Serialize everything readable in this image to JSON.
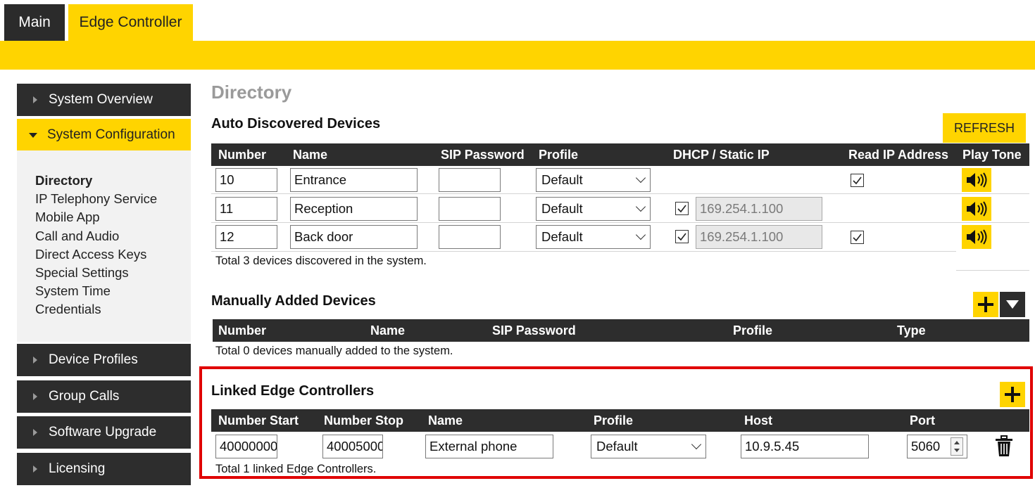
{
  "tabs": {
    "main": "Main",
    "edge": "Edge Controller"
  },
  "sidebar": {
    "system_overview": "System Overview",
    "system_configuration": "System Configuration",
    "sub_items": [
      "Directory",
      "IP Telephony Service",
      "Mobile App",
      "Call and Audio",
      "Direct Access Keys",
      "Special Settings",
      "System Time",
      "Credentials"
    ],
    "device_profiles": "Device Profiles",
    "group_calls": "Group Calls",
    "software_upgrade": "Software Upgrade",
    "licensing": "Licensing"
  },
  "page_title": "Directory",
  "auto": {
    "title": "Auto Discovered Devices",
    "refresh_label": "REFRESH",
    "headers": [
      "Number",
      "Name",
      "SIP Password",
      "Profile",
      "DHCP / Static IP",
      "Read IP Address",
      "Play Tone"
    ],
    "rows": [
      {
        "number": "10",
        "name": "Entrance",
        "sip_password": "",
        "profile": "Default",
        "static_ip_checked": false,
        "ip": "",
        "read_ip_checked": true
      },
      {
        "number": "11",
        "name": "Reception",
        "sip_password": "",
        "profile": "Default",
        "static_ip_checked": true,
        "ip": "169.254.1.100",
        "read_ip_checked": false
      },
      {
        "number": "12",
        "name": "Back door",
        "sip_password": "",
        "profile": "Default",
        "static_ip_checked": true,
        "ip": "169.254.1.100",
        "read_ip_checked": true
      }
    ],
    "total_note": "Total 3 devices discovered in the system."
  },
  "manual": {
    "title": "Manually Added Devices",
    "headers": [
      "Number",
      "Name",
      "SIP Password",
      "Profile",
      "Type"
    ],
    "total_note": "Total 0 devices manually added to the system."
  },
  "linked": {
    "title": "Linked Edge Controllers",
    "headers": [
      "Number Start",
      "Number Stop",
      "Name",
      "Profile",
      "Host",
      "Port"
    ],
    "row": {
      "number_start": "40000000",
      "number_stop": "40005000",
      "name": "External phone",
      "profile": "Default",
      "host": "10.9.5.45",
      "port": "5060"
    },
    "total_note": "Total 1 linked Edge Controllers."
  },
  "colors": {
    "accent": "#ffd400",
    "dark": "#2d2d2d",
    "highlight": "#e00000"
  }
}
